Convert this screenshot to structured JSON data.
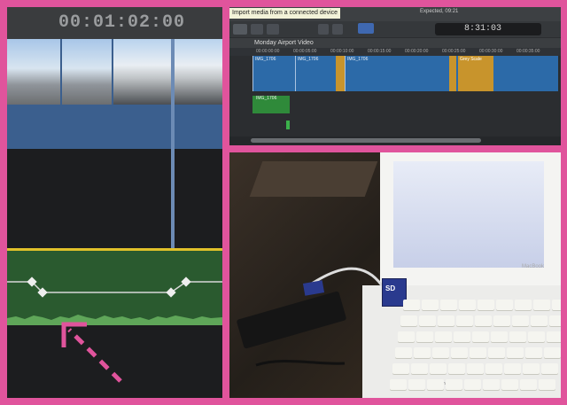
{
  "left_panel": {
    "timecode": "00:01:02:00"
  },
  "timeline_screenshot": {
    "tooltip": "Import media from a connected device",
    "menubar_extra": "Expected, 09:21",
    "dashboard_timecode": "8:31:03",
    "project_name": "Monday Airport Video",
    "ruler_ticks": [
      "00:00:00:00",
      "00:00:05:00",
      "00:00:10:00",
      "00:00:15:00",
      "00:00:20:00",
      "00:00:25:00",
      "00:00:30:00",
      "00:00:35:00"
    ],
    "clips": [
      {
        "name": "IMG_1706"
      },
      {
        "name": "IMG_1706"
      },
      {
        "name": "IMG_1706"
      },
      {
        "name": "Grey Scale"
      }
    ],
    "connected_clip": "IMG_1706"
  },
  "photo": {
    "laptop_brand": "MacBook",
    "sd_card_label": "SD",
    "keyboard_keys": [
      "option",
      "command"
    ]
  },
  "colors": {
    "border": "#e0549c",
    "clip_blue": "#3b5f8e",
    "audio_green": "#2a5a2f",
    "audio_border": "#e0c12a",
    "arrow": "#e0549c"
  }
}
